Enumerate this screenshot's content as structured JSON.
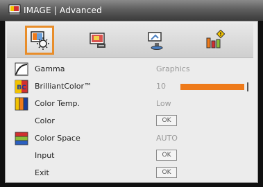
{
  "window": {
    "title": "IMAGE | Advanced"
  },
  "tabs": [
    {
      "name": "image",
      "active": true
    },
    {
      "name": "display",
      "active": false
    },
    {
      "name": "setup",
      "active": false
    },
    {
      "name": "options",
      "active": false
    }
  ],
  "rows": {
    "gamma": {
      "label": "Gamma",
      "value": "Graphics"
    },
    "brilliant": {
      "label": "BrilliantColor™",
      "value": "10",
      "level": 0.96
    },
    "temp": {
      "label": "Color Temp.",
      "value": "Low"
    },
    "color": {
      "label": "Color",
      "button": "OK"
    },
    "space": {
      "label": "Color Space",
      "value": "AUTO"
    },
    "input": {
      "label": "Input",
      "button": "OK"
    },
    "exit": {
      "label": "Exit",
      "button": "OK"
    }
  },
  "colors": {
    "accent": "#ee7a1a",
    "value_text": "#9a9a9a"
  }
}
